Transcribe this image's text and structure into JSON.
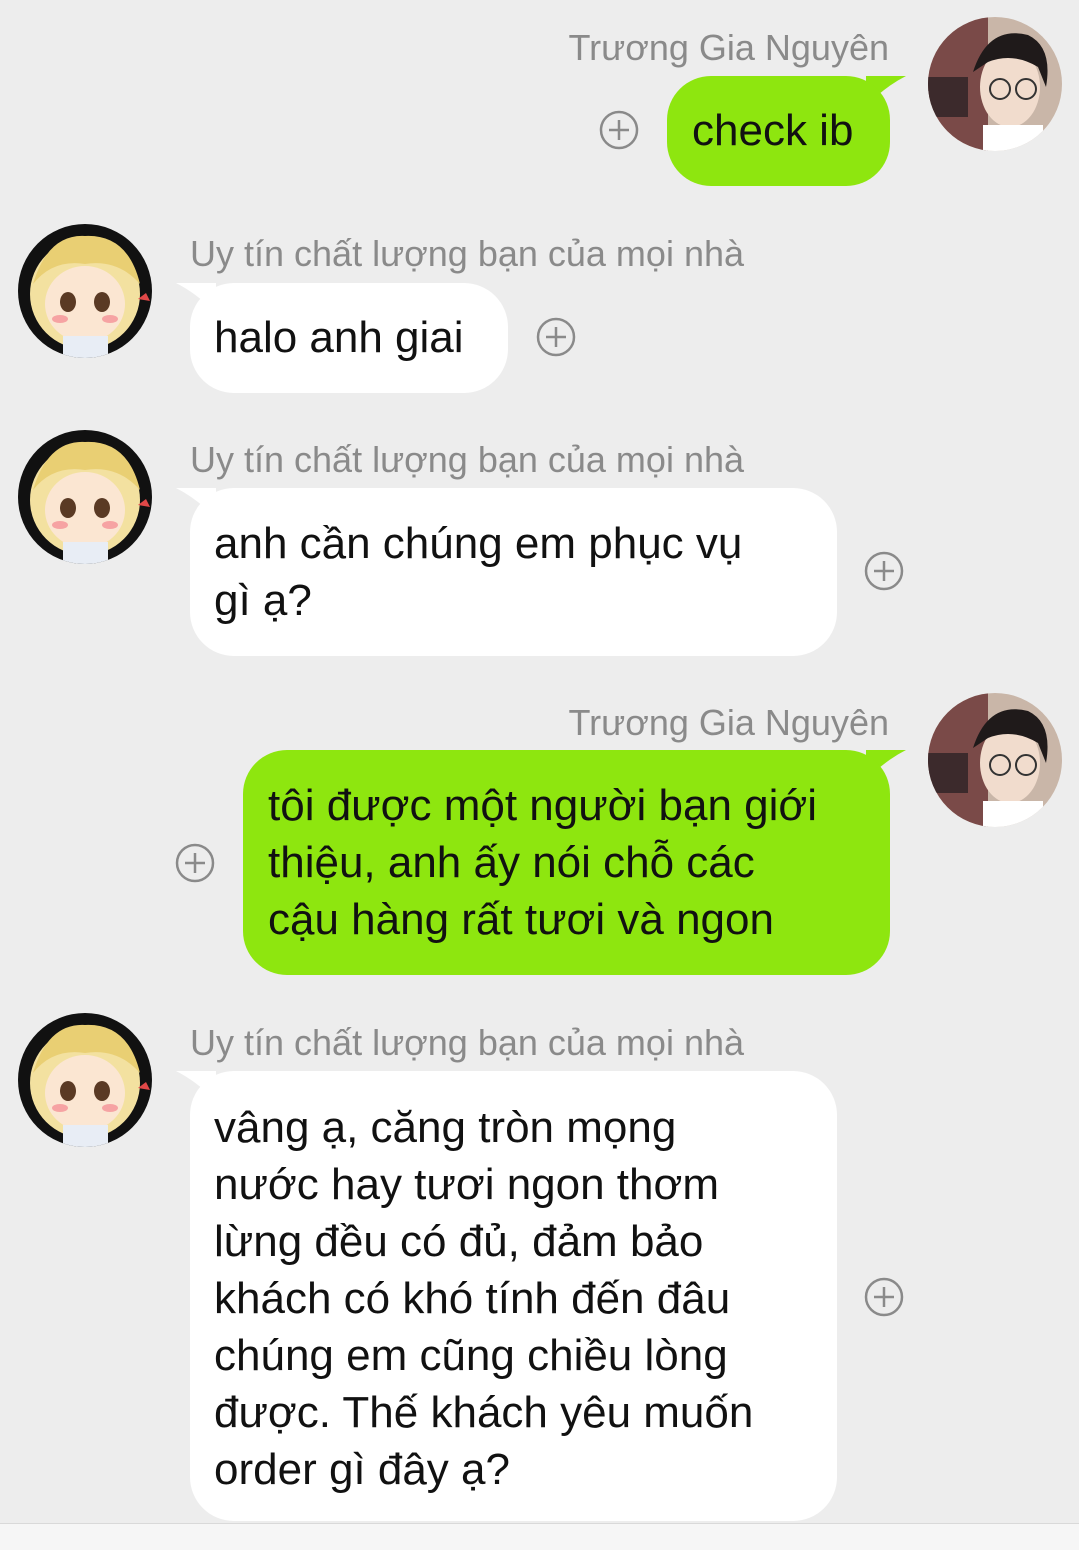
{
  "messages": [
    {
      "sender": "Trương Gia Nguyên",
      "side": "me",
      "text": "check ib"
    },
    {
      "sender": "Uy tín chất lượng bạn của mọi nhà",
      "side": "them",
      "text": "halo anh giai"
    },
    {
      "sender": "Uy tín chất lượng bạn của mọi nhà",
      "side": "them",
      "lines": [
        "anh cần chúng em phục vụ",
        "gì ạ?"
      ]
    },
    {
      "sender": "Trương Gia Nguyên",
      "side": "me",
      "lines": [
        "tôi được một người bạn giới",
        "thiệu, anh ấy nói chỗ các",
        "cậu hàng rất tươi và ngon"
      ]
    },
    {
      "sender": "Uy tín chất lượng bạn của mọi nhà",
      "side": "them",
      "lines": [
        "vâng ạ, căng tròn mọng",
        "nước hay tươi ngon thơm",
        "lừng đều có đủ, đảm bảo",
        "khách có khó tính đến đâu",
        "chúng em cũng chiều lòng",
        "được. Thế khách yêu muốn",
        "order gì đây ạ?"
      ]
    }
  ],
  "icons": {
    "reaction": "plus-circle-icon",
    "avatar_me": "avatar-photo-man-glasses",
    "avatar_them": "avatar-chibi-blonde"
  },
  "colors": {
    "background": "#ededed",
    "bubble_me": "#8ee60f",
    "bubble_them": "#ffffff",
    "name_text": "#8a8a8a"
  }
}
